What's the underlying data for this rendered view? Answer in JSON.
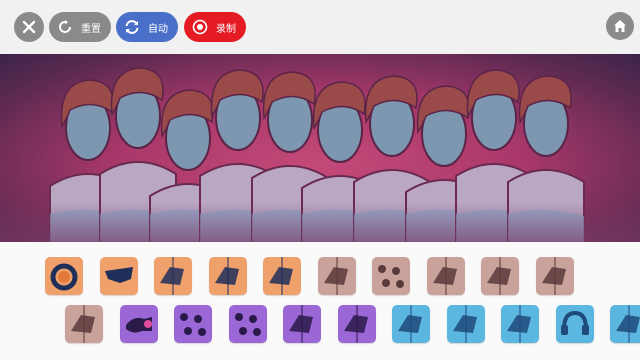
{
  "toolbar": {
    "close_icon": "close-icon",
    "reset_label": "重置",
    "auto_label": "自动",
    "record_label": "录制",
    "home_icon": "home-icon"
  },
  "colors": {
    "toolbar_bg": "#f1f1f1",
    "gray_button": "#8a8a8a",
    "auto_button": "#4a6fc9",
    "record_button": "#e51b24",
    "stage_center": "#c44a78",
    "stage_edge": "#3c2448",
    "orange_tile": "#f0a06a",
    "tan_tile": "#c9a39b",
    "purple_tile": "#9b67d6",
    "cyan_tile": "#5bb7e0"
  },
  "stage": {
    "singers": 10
  },
  "sound_tiles": {
    "row1": [
      {
        "name": "sound-tile-orange-1",
        "color": "#f0a06a",
        "icon": "ring-icon"
      },
      {
        "name": "sound-tile-orange-2",
        "color": "#f0a06a",
        "icon": "glasses-icon"
      },
      {
        "name": "sound-tile-orange-3",
        "color": "#f0a06a",
        "icon": "shape-icon"
      },
      {
        "name": "sound-tile-orange-4",
        "color": "#f0a06a",
        "icon": "shape-icon"
      },
      {
        "name": "sound-tile-orange-5",
        "color": "#f0a06a",
        "icon": "shape-icon"
      },
      {
        "name": "sound-tile-tan-1",
        "color": "#c9a39b",
        "icon": "shape-icon"
      },
      {
        "name": "sound-tile-tan-2",
        "color": "#c9a39b",
        "icon": "dots-icon"
      },
      {
        "name": "sound-tile-tan-3",
        "color": "#c9a39b",
        "icon": "shape-icon"
      },
      {
        "name": "sound-tile-tan-4",
        "color": "#c9a39b",
        "icon": "shape-icon"
      },
      {
        "name": "sound-tile-tan-5",
        "color": "#c9a39b",
        "icon": "shape-icon"
      }
    ],
    "row2": [
      {
        "name": "sound-tile-tan-6",
        "color": "#c9a39b",
        "icon": "shape-icon"
      },
      {
        "name": "sound-tile-purple-1",
        "color": "#9b67d6",
        "icon": "pipe-icon"
      },
      {
        "name": "sound-tile-purple-2",
        "color": "#9b67d6",
        "icon": "dots-icon"
      },
      {
        "name": "sound-tile-purple-3",
        "color": "#9b67d6",
        "icon": "dots-icon"
      },
      {
        "name": "sound-tile-purple-4",
        "color": "#9b67d6",
        "icon": "shape-icon"
      },
      {
        "name": "sound-tile-purple-5",
        "color": "#9b67d6",
        "icon": "shape-icon"
      },
      {
        "name": "sound-tile-cyan-1",
        "color": "#5bb7e0",
        "icon": "shape-icon"
      },
      {
        "name": "sound-tile-cyan-2",
        "color": "#5bb7e0",
        "icon": "shape-icon"
      },
      {
        "name": "sound-tile-cyan-3",
        "color": "#5bb7e0",
        "icon": "shape-icon"
      },
      {
        "name": "sound-tile-cyan-4",
        "color": "#5bb7e0",
        "icon": "headphones-icon"
      },
      {
        "name": "sound-tile-cyan-5",
        "color": "#5bb7e0",
        "icon": "shape-icon"
      }
    ]
  }
}
